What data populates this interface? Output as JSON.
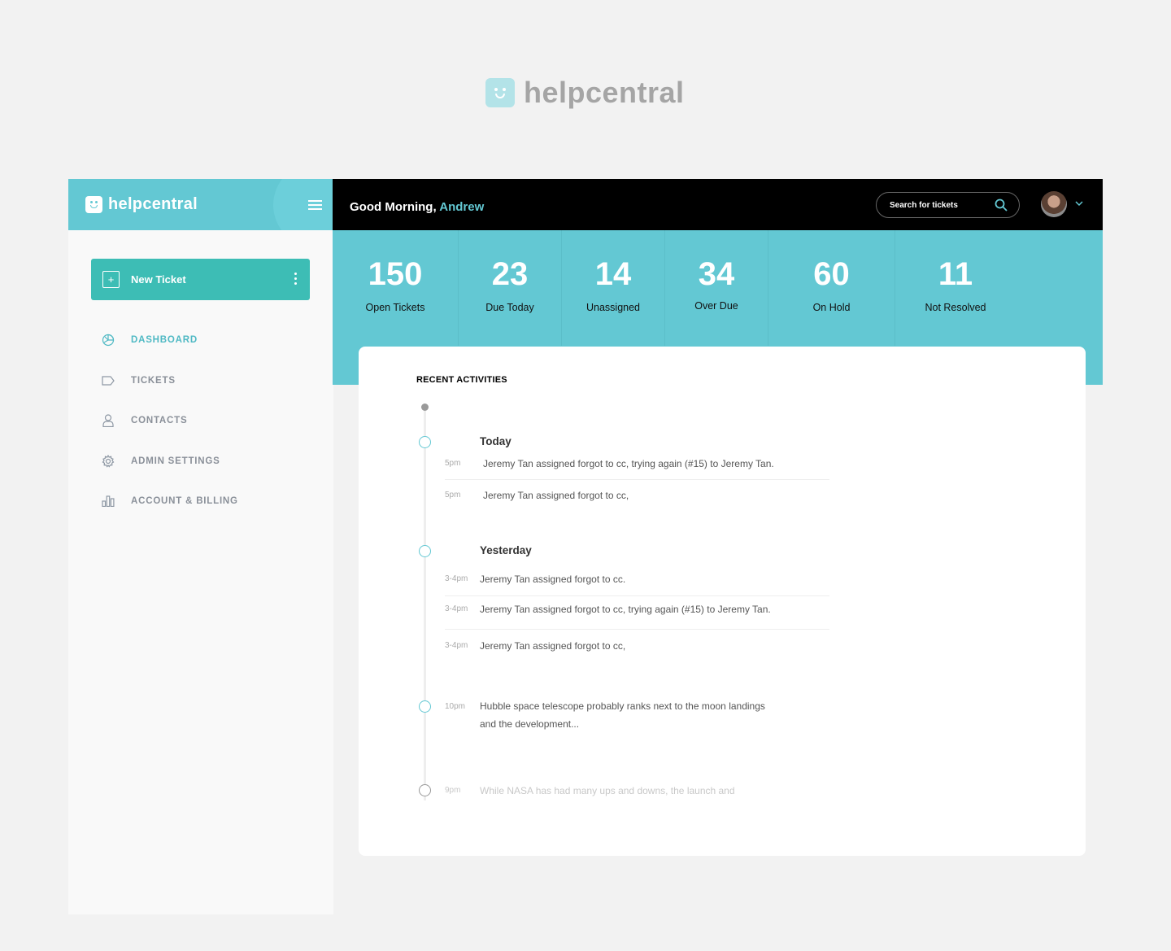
{
  "brand": {
    "name": "helpcentral"
  },
  "sidebar": {
    "brand": "helpcentral",
    "new_ticket_label": "New Ticket",
    "new_ticket_plus": "+",
    "items": [
      {
        "label": "DASHBOARD",
        "icon": "dashboard-icon",
        "active": true
      },
      {
        "label": "TICKETS",
        "icon": "tag-icon",
        "active": false
      },
      {
        "label": "CONTACTS",
        "icon": "user-icon",
        "active": false
      },
      {
        "label": "ADMIN SETTINGS",
        "icon": "gear-icon",
        "active": false
      },
      {
        "label": "ACCOUNT & BILLING",
        "icon": "bar-chart-icon",
        "active": false
      }
    ]
  },
  "header": {
    "greeting": "Good Morning,",
    "user": "Andrew",
    "search_placeholder": "Search for tickets"
  },
  "stats": [
    {
      "value": "150",
      "label": "Open Tickets"
    },
    {
      "value": "23",
      "label": "Due Today"
    },
    {
      "value": "14",
      "label": "Unassigned"
    },
    {
      "value": "34",
      "label": "Over Due"
    },
    {
      "value": "60",
      "label": "On Hold"
    },
    {
      "value": "11",
      "label": "Not Resolved"
    }
  ],
  "activities": {
    "title": "RECENT ACTIVITIES",
    "today": {
      "label": "Today",
      "items": [
        {
          "time": "5pm",
          "text": "Jeremy Tan assigned forgot to cc, trying again (#15) to Jeremy Tan."
        },
        {
          "time": "5pm",
          "text": "Jeremy Tan assigned forgot to cc,"
        }
      ]
    },
    "yesterday": {
      "label": "Yesterday",
      "items": [
        {
          "time": "3-4pm",
          "text": "Jeremy Tan assigned forgot to cc."
        },
        {
          "time": "3-4pm",
          "text": "Jeremy Tan assigned forgot to cc, trying again (#15) to Jeremy Tan."
        },
        {
          "time": "3-4pm",
          "text": "Jeremy Tan assigned forgot to cc,"
        }
      ]
    },
    "later": [
      {
        "time": "10pm",
        "line1": "Hubble space telescope probably ranks next to the moon landings",
        "line2": "and the development..."
      },
      {
        "time": "9pm",
        "line1": "While NASA has had many ups and downs, the launch and"
      }
    ]
  },
  "colors": {
    "accent": "#63c8d3",
    "button": "#3dbdb5",
    "header_bg": "#000000",
    "page_bg": "#f2f2f2"
  }
}
